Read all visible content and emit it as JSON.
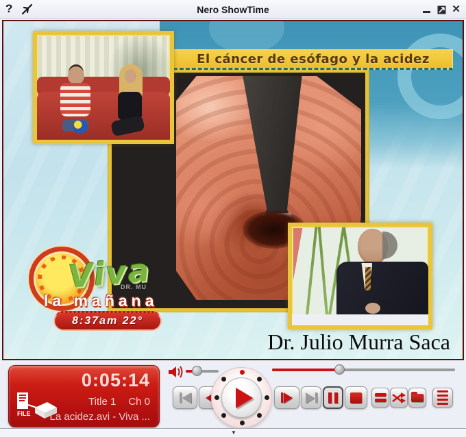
{
  "window": {
    "title": "Nero ShowTime",
    "icons": {
      "help": "?",
      "close": "✕",
      "collapse": "▼"
    }
  },
  "video": {
    "banner_text": "El cáncer de esófago y la acidez",
    "caption": "Dr. Julio Murra Saca",
    "watermark": "DR. MU",
    "logo": {
      "word_top": "Viva",
      "word_bottom": "la mañana",
      "time_temp": "8:37am 22°"
    }
  },
  "display": {
    "time": "0:05:14",
    "title_label": "Title 1",
    "channel_label": "Ch 0",
    "file_name": "La acidez.avi - Viva ...",
    "source_icon_label": "FILE"
  },
  "controls": {
    "volume_pct": 35,
    "seek_pct": 37,
    "buttons": [
      "previous",
      "rewind",
      "play",
      "fast-forward",
      "next",
      "pause",
      "stop",
      "repeat",
      "shuffle",
      "browse",
      "playlist"
    ]
  },
  "colors": {
    "accent_red": "#c41212",
    "display_red": "#cc1d14",
    "frame_yellow": "#e9c53c",
    "banner_yellow": "#f0c families",
    "teal": "#3e94b6",
    "video_border": "#5d0f10"
  }
}
